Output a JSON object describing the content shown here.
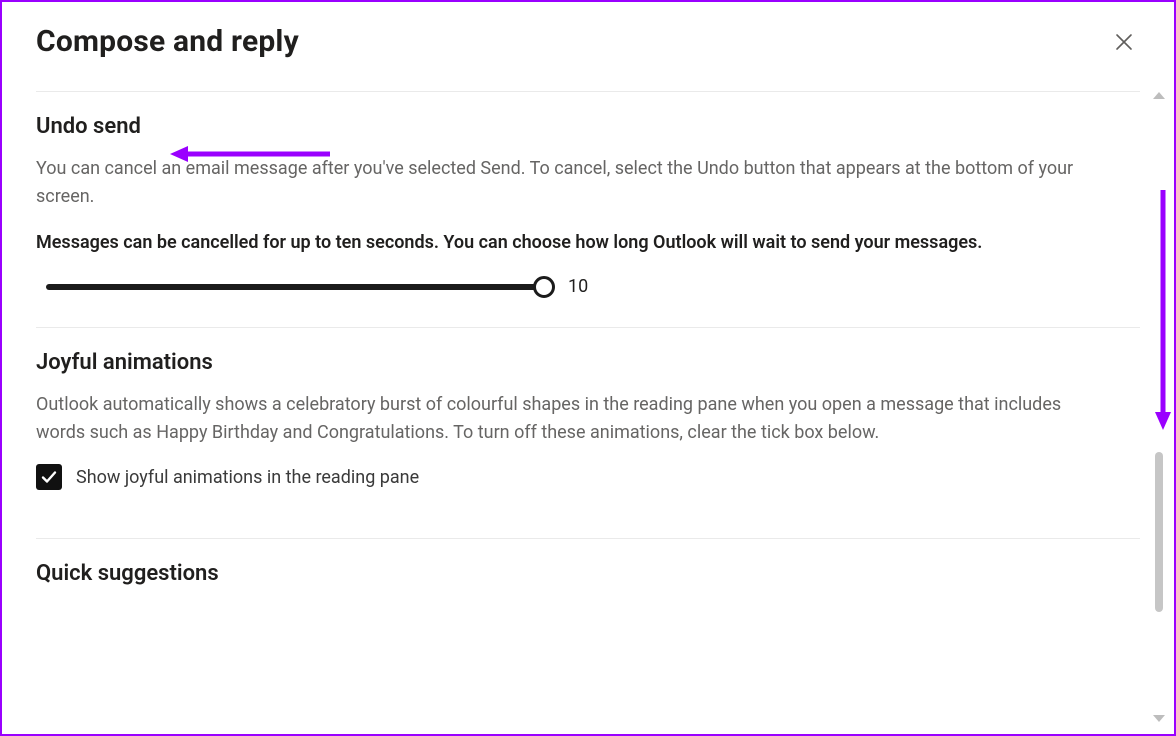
{
  "header": {
    "title": "Compose and reply"
  },
  "undo_send": {
    "heading": "Undo send",
    "description": "You can cancel an email message after you've selected Send. To cancel, select the Undo button that appears at the bottom of your screen.",
    "bold_note": "Messages can be cancelled for up to ten seconds. You can choose how long Outlook will wait to send your messages.",
    "slider": {
      "value": 10,
      "min": 0,
      "max": 10,
      "value_label": "10"
    }
  },
  "joyful": {
    "heading": "Joyful animations",
    "description": "Outlook automatically shows a celebratory burst of colourful shapes in the reading pane when you open a message that includes words such as Happy Birthday and Congratulations. To turn off these animations, clear the tick box below.",
    "checkbox_label": "Show joyful animations in the reading pane",
    "checkbox_checked": true
  },
  "quick_suggestions": {
    "heading": "Quick suggestions"
  },
  "annotations": {
    "color": "#9a00ff"
  }
}
